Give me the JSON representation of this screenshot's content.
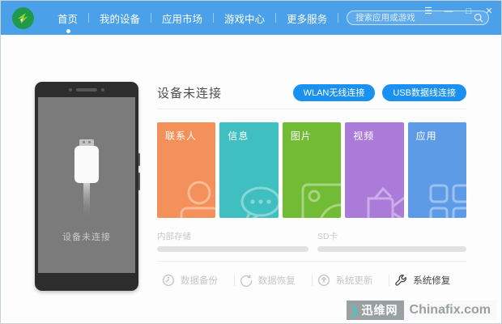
{
  "header": {
    "nav_items": [
      {
        "label": "首页",
        "active": true
      },
      {
        "label": "我的设备",
        "active": false
      },
      {
        "label": "应用市场",
        "active": false
      },
      {
        "label": "游戏中心",
        "active": false
      },
      {
        "label": "更多服务",
        "active": false
      }
    ],
    "search": {
      "placeholder": "搜索应用或游戏"
    },
    "window_controls": {
      "menu": "☰",
      "minimize": "—",
      "maximize": "□",
      "close": "✕"
    }
  },
  "phone": {
    "status": "设备未连接"
  },
  "main": {
    "title": "设备未连接",
    "connect_buttons": [
      {
        "label": "WLAN无线连接"
      },
      {
        "label": "USB数据线连接"
      }
    ],
    "tiles": [
      {
        "label": "联系人",
        "color": "#F4915A",
        "icon": "contact-icon"
      },
      {
        "label": "信息",
        "color": "#3FBFC0",
        "icon": "message-icon"
      },
      {
        "label": "图片",
        "color": "#72BC35",
        "icon": "picture-icon"
      },
      {
        "label": "视频",
        "color": "#AB7BD9",
        "icon": "video-icon"
      },
      {
        "label": "应用",
        "color": "#5D9BE7",
        "icon": "apps-icon"
      }
    ],
    "storage": [
      {
        "label": "内部存储",
        "percent": 0
      },
      {
        "label": "SD卡",
        "percent": 0
      }
    ],
    "actions": [
      {
        "label": "数据备份",
        "enabled": false,
        "icon": "backup-icon"
      },
      {
        "label": "数据恢复",
        "enabled": false,
        "icon": "restore-icon"
      },
      {
        "label": "系统更新",
        "enabled": false,
        "icon": "update-icon"
      },
      {
        "label": "系统修复",
        "enabled": true,
        "icon": "repair-icon"
      }
    ]
  },
  "watermark": {
    "site_name": "迅维网",
    "domain": "Chinafix.com"
  },
  "colors": {
    "header_bg": "#4BA0EA",
    "accent_button": "#1A90F0",
    "phone_frame": "#2D2D2D"
  }
}
